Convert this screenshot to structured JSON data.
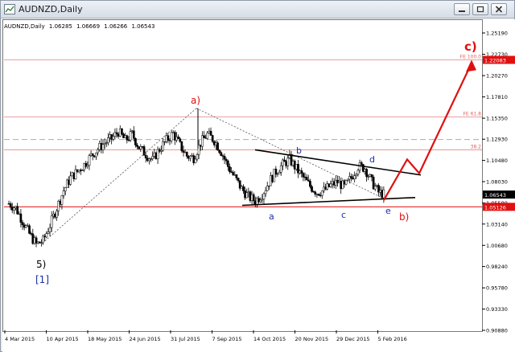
{
  "window": {
    "title": "AUDNZD,Daily",
    "buttons": [
      "minimize",
      "restore",
      "close"
    ]
  },
  "header": {
    "symbol": "AUDNZD,Daily",
    "open": "1.06285",
    "high": "1.06669",
    "low": "1.06266",
    "close": "1.06543"
  },
  "colors": {
    "up": "#000000",
    "down": "#000000",
    "fib_line": "#e8a0a0",
    "fib_text": "#e06060",
    "wave_red": "#e01010",
    "wave_blue": "#1a2ea8",
    "price_box": "#000000",
    "level_box": "#e01010"
  },
  "y_axis": {
    "ticks": [
      "1.25190",
      "1.22730",
      "1.20270",
      "1.17810",
      "1.15350",
      "1.12930",
      "1.10480",
      "1.08030",
      "1.05580",
      "1.03140",
      "1.00680",
      "0.98240",
      "0.95780",
      "0.93330",
      "0.90880"
    ],
    "current_price": "1.06543",
    "level_price": "1.05126",
    "target_price": "1.22083"
  },
  "x_axis": {
    "ticks": [
      "4 Mar 2015",
      "10 Apr 2015",
      "18 May 2015",
      "24 Jun 2015",
      "31 Jul 2015",
      "7 Sep 2015",
      "14 Oct 2015",
      "20 Nov 2015",
      "29 Dec 2015",
      "5 Feb 2016"
    ]
  },
  "fib_levels": [
    {
      "label": "FE 100.0",
      "price": 1.22083
    },
    {
      "label": "FE 61.8",
      "price": 1.155
    },
    {
      "label": "38.2",
      "price": 1.117
    }
  ],
  "wave_labels": {
    "five": "5)",
    "one_bracket": "[1]",
    "a_paren": "a)",
    "b_paren": "b)",
    "c_target": "c)",
    "a": "a",
    "b": "b",
    "c": "c",
    "d": "d",
    "e": "e"
  },
  "chart_data": {
    "type": "candlestick",
    "symbol": "AUDNZD",
    "timeframe": "Daily",
    "ylim": [
      0.9088,
      1.2519
    ],
    "x": [
      "4 Mar 2015",
      "10 Apr 2015",
      "18 May 2015",
      "24 Jun 2015",
      "31 Jul 2015",
      "7 Sep 2015",
      "14 Oct 2015",
      "20 Nov 2015",
      "29 Dec 2015",
      "5 Feb 2016"
    ],
    "close_by_tick": [
      1.05,
      1.01,
      1.085,
      1.12,
      1.115,
      1.11,
      1.06,
      1.095,
      1.07,
      1.065
    ],
    "series": [
      {
        "name": "AUDNZD",
        "values": [
          1.055,
          1.05,
          1.035,
          1.02,
          1.008,
          1.012,
          1.03,
          1.05,
          1.07,
          1.085,
          1.092,
          1.1,
          1.11,
          1.118,
          1.125,
          1.13,
          1.138,
          1.128,
          1.135,
          1.12,
          1.112,
          1.105,
          1.118,
          1.128,
          1.136,
          1.122,
          1.11,
          1.108,
          1.125,
          1.135,
          1.128,
          1.115,
          1.098,
          1.085,
          1.072,
          1.063,
          1.058,
          1.066,
          1.08,
          1.092,
          1.1,
          1.106,
          1.095,
          1.085,
          1.075,
          1.068,
          1.07,
          1.076,
          1.08,
          1.074,
          1.085,
          1.098,
          1.096,
          1.08,
          1.068,
          1.065
        ]
      }
    ],
    "horizontal_levels": [
      1.22083,
      1.155,
      1.129,
      1.117,
      1.05126
    ],
    "current_price": 1.06543
  }
}
